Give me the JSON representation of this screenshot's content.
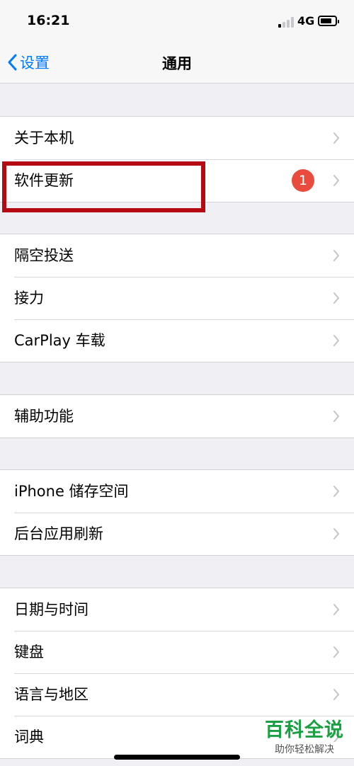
{
  "status_bar": {
    "time": "16:21",
    "network": "4G",
    "signal_bars_active": 1,
    "signal_bars_total": 4,
    "battery_level": 0.8
  },
  "nav": {
    "back_label": "设置",
    "title": "通用"
  },
  "groups": [
    {
      "rows": [
        {
          "label": "关于本机"
        },
        {
          "label": "软件更新",
          "badge": "1"
        }
      ]
    },
    {
      "rows": [
        {
          "label": "隔空投送"
        },
        {
          "label": "接力"
        },
        {
          "label": "CarPlay 车载"
        }
      ]
    },
    {
      "rows": [
        {
          "label": "辅助功能"
        }
      ]
    },
    {
      "rows": [
        {
          "label": "iPhone 储存空间"
        },
        {
          "label": "后台应用刷新"
        }
      ]
    },
    {
      "rows": [
        {
          "label": "日期与时间"
        },
        {
          "label": "键盘"
        },
        {
          "label": "语言与地区"
        },
        {
          "label": "词典"
        }
      ]
    }
  ],
  "watermark": {
    "brand": "百科全说",
    "slogan": "助你轻松解决"
  },
  "colors": {
    "accent": "#007aff",
    "badge": "#e94c3d",
    "highlight": "#b50a11",
    "watermark": "#1aa042"
  }
}
